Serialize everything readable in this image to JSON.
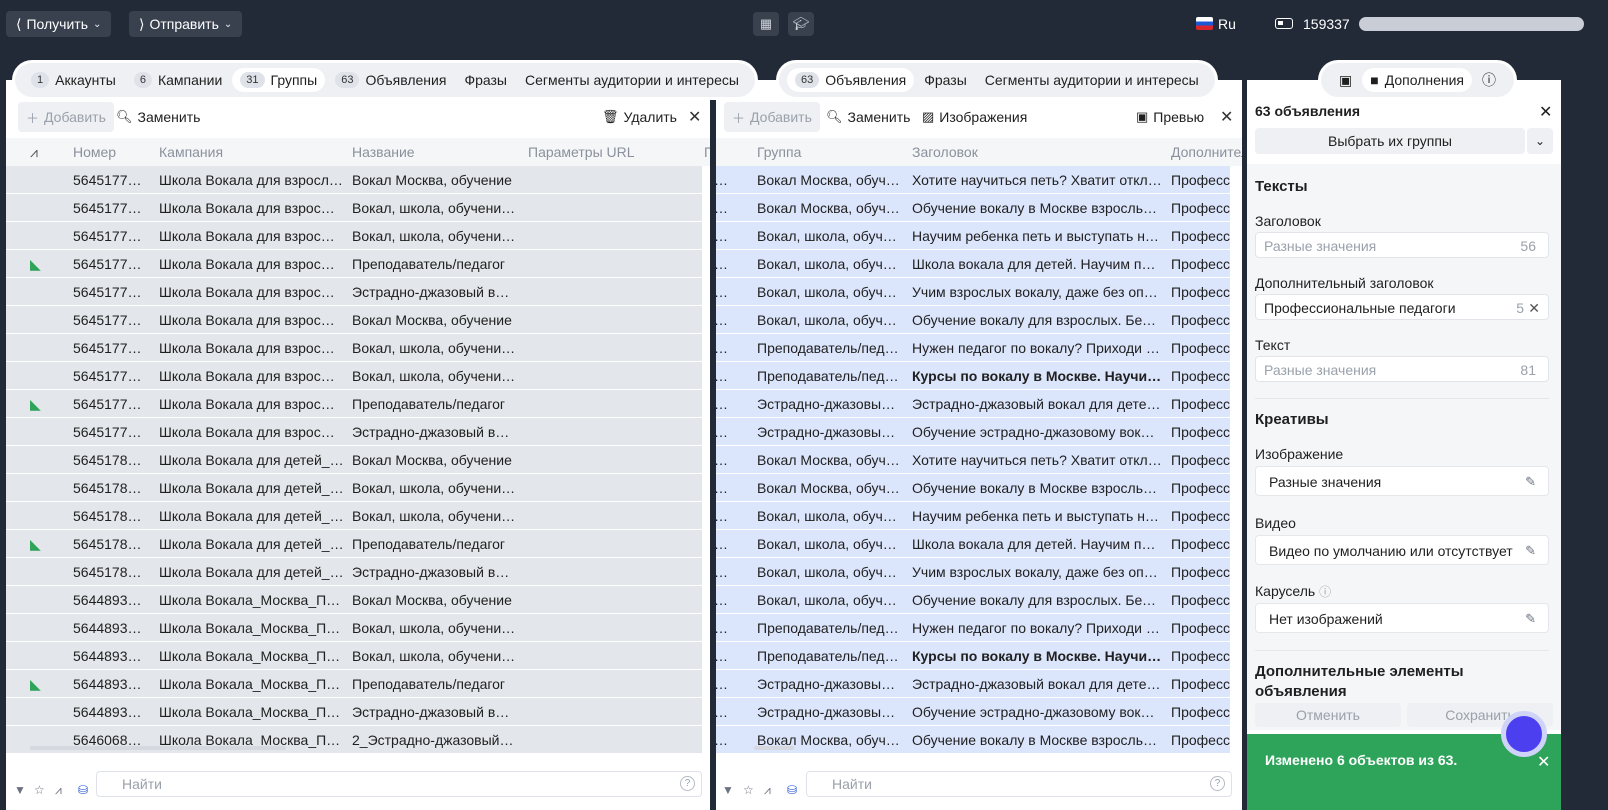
{
  "topbar": {
    "receive_label": "Получить",
    "send_label": "Отправить",
    "language": "Ru",
    "balance": "159337"
  },
  "left_panel": {
    "tabs": [
      {
        "count": "1",
        "label": "Аккаунты"
      },
      {
        "count": "6",
        "label": "Кампании"
      },
      {
        "count": "31",
        "label": "Группы"
      },
      {
        "count": "63",
        "label": "Объявления"
      },
      {
        "count": "",
        "label": "Фразы"
      },
      {
        "count": "",
        "label": "Сегменты аудитории и интересы"
      }
    ],
    "toolbar": {
      "add": "Добавить",
      "replace": "Заменить",
      "delete": "Удалить"
    },
    "columns": [
      "Номер",
      "Кампания",
      "Название",
      "Параметры URL"
    ],
    "rows": [
      {
        "flag": false,
        "num": "5645177…",
        "campaign": "Школа Вокала для взросл…",
        "name": "Вокал Москва, обучение"
      },
      {
        "flag": false,
        "num": "5645177…",
        "campaign": "Школа Вокала для взрос…",
        "name": "Вокал, школа, обучени…"
      },
      {
        "flag": false,
        "num": "5645177…",
        "campaign": "Школа Вокала для взрос…",
        "name": "Вокал, школа, обучени…"
      },
      {
        "flag": true,
        "num": "5645177…",
        "campaign": "Школа Вокала для взрос…",
        "name": "Преподаватель/педагог"
      },
      {
        "flag": false,
        "num": "5645177…",
        "campaign": "Школа Вокала для взрос…",
        "name": "Эстрадно-джазовый в…"
      },
      {
        "flag": false,
        "num": "5645177…",
        "campaign": "Школа Вокала для взрос…",
        "name": "Вокал Москва, обучение"
      },
      {
        "flag": false,
        "num": "5645177…",
        "campaign": "Школа Вокала для взрос…",
        "name": "Вокал, школа, обучени…"
      },
      {
        "flag": false,
        "num": "5645177…",
        "campaign": "Школа Вокала для взрос…",
        "name": "Вокал, школа, обучени…"
      },
      {
        "flag": true,
        "num": "5645177…",
        "campaign": "Школа Вокала для взрос…",
        "name": "Преподаватель/педагог"
      },
      {
        "flag": false,
        "num": "5645177…",
        "campaign": "Школа Вокала для взрос…",
        "name": "Эстрадно-джазовый в…"
      },
      {
        "flag": false,
        "num": "5645178…",
        "campaign": "Школа Вокала для детей_…",
        "name": "Вокал Москва, обучение"
      },
      {
        "flag": false,
        "num": "5645178…",
        "campaign": "Школа Вокала для детей_…",
        "name": "Вокал, школа, обучени…"
      },
      {
        "flag": false,
        "num": "5645178…",
        "campaign": "Школа Вокала для детей_…",
        "name": "Вокал, школа, обучени…"
      },
      {
        "flag": true,
        "num": "5645178…",
        "campaign": "Школа Вокала для детей_…",
        "name": "Преподаватель/педагог"
      },
      {
        "flag": false,
        "num": "5645178…",
        "campaign": "Школа Вокала для детей_…",
        "name": "Эстрадно-джазовый в…"
      },
      {
        "flag": false,
        "num": "5644893…",
        "campaign": "Школа Вокала_Москва_П…",
        "name": "Вокал Москва, обучение"
      },
      {
        "flag": false,
        "num": "5644893…",
        "campaign": "Школа Вокала_Москва_П…",
        "name": "Вокал, школа, обучени…"
      },
      {
        "flag": false,
        "num": "5644893…",
        "campaign": "Школа Вокала_Москва_П…",
        "name": "Вокал, школа, обучени…"
      },
      {
        "flag": true,
        "num": "5644893…",
        "campaign": "Школа Вокала_Москва_П…",
        "name": "Преподаватель/педагог"
      },
      {
        "flag": false,
        "num": "5644893…",
        "campaign": "Школа Вокала_Москва_П…",
        "name": "Эстрадно-джазовый в…"
      },
      {
        "flag": false,
        "num": "5646068…",
        "campaign": "Школа Вокала_Москва_П…",
        "name": "2_Эстрадно-джазовый…"
      }
    ],
    "search_placeholder": "Найти"
  },
  "mid_panel": {
    "tabs": [
      {
        "count": "63",
        "label": "Объявления"
      },
      {
        "count": "",
        "label": "Фразы"
      },
      {
        "count": "",
        "label": "Сегменты аудитории и интересы"
      }
    ],
    "toolbar": {
      "add": "Добавить",
      "replace": "Заменить",
      "images": "Изображения",
      "preview": "Превью"
    },
    "columns": [
      "Группа",
      "Заголовок",
      "Дополнител"
    ],
    "rows": [
      {
        "group": "Вокал Москва, обуч…",
        "title": "Хотите научиться петь? Хватит откл…",
        "bold": false,
        "extra": "Професс"
      },
      {
        "group": "Вокал Москва, обуч…",
        "title": "Обучение вокалу в Москве взросль…",
        "bold": false,
        "extra": "Професс"
      },
      {
        "group": "Вокал, школа, обуч…",
        "title": "Научим ребенка петь и выступать н…",
        "bold": false,
        "extra": "Професс"
      },
      {
        "group": "Вокал, школа, обуч…",
        "title": "Школа вокала для детей. Научим пе…",
        "bold": false,
        "extra": "Професс"
      },
      {
        "group": "Вокал, школа, обуч…",
        "title": "Учим взрослых вокалу, даже без оп…",
        "bold": false,
        "extra": "Професс"
      },
      {
        "group": "Вокал, школа, обуч…",
        "title": "Обучение вокалу для взрослых. Без…",
        "bold": false,
        "extra": "Професс"
      },
      {
        "group": "Преподаватель/пед…",
        "title": "Нужен педагог по вокалу? Приходи …",
        "bold": false,
        "extra": "Професс"
      },
      {
        "group": "Преподаватель/пед…",
        "title": "Курсы по вокалу в Москве. Научи…",
        "bold": true,
        "extra": "Професс"
      },
      {
        "group": "Эстрадно-джазовы…",
        "title": "Эстрадно-джазовый вокал для дете…",
        "bold": false,
        "extra": "Професс"
      },
      {
        "group": "Эстрадно-джазовы…",
        "title": "Обучение эстрадно-джазовому вок…",
        "bold": false,
        "extra": "Професс"
      },
      {
        "group": "Вокал Москва, обуч…",
        "title": "Хотите научиться петь? Хватит откл…",
        "bold": false,
        "extra": "Професс"
      },
      {
        "group": "Вокал Москва, обуч…",
        "title": "Обучение вокалу в Москве взросль…",
        "bold": false,
        "extra": "Професс"
      },
      {
        "group": "Вокал, школа, обуч…",
        "title": "Научим ребенка петь и выступать н…",
        "bold": false,
        "extra": "Професс"
      },
      {
        "group": "Вокал, школа, обуч…",
        "title": "Школа вокала для детей. Научим пе…",
        "bold": false,
        "extra": "Професс"
      },
      {
        "group": "Вокал, школа, обуч…",
        "title": "Учим взрослых вокалу, даже без оп…",
        "bold": false,
        "extra": "Професс"
      },
      {
        "group": "Вокал, школа, обуч…",
        "title": "Обучение вокалу для взрослых. Без…",
        "bold": false,
        "extra": "Професс"
      },
      {
        "group": "Преподаватель/пед…",
        "title": "Нужен педагог по вокалу? Приходи …",
        "bold": false,
        "extra": "Професс"
      },
      {
        "group": "Преподаватель/пед…",
        "title": "Курсы по вокалу в Москве. Научи…",
        "bold": true,
        "extra": "Професс"
      },
      {
        "group": "Эстрадно-джазовы…",
        "title": "Эстрадно-джазовый вокал для дете…",
        "bold": false,
        "extra": "Професс"
      },
      {
        "group": "Эстрадно-джазовы…",
        "title": "Обучение эстрадно-джазовому вок…",
        "bold": false,
        "extra": "Професс"
      },
      {
        "group": "Вокал Москва, обуч…",
        "title": "Обучение вокалу в Москве взросль…",
        "bold": false,
        "extra": "Професс"
      }
    ],
    "search_placeholder": "Найти"
  },
  "right_panel": {
    "tab_label": "Дополнения",
    "heading": "63 объявления",
    "choose_group": "Выбрать их группы",
    "texts_section": "Тексты",
    "title_label": "Заголовок",
    "title_placeholder": "Разные значения",
    "title_count": "56",
    "extra_title_label": "Дополнительный заголовок",
    "extra_title_value": "Профессиональные педагоги",
    "extra_title_count": "5",
    "text_label": "Текст",
    "text_placeholder": "Разные значения",
    "text_count": "81",
    "creatives_section": "Креативы",
    "image_label": "Изображение",
    "image_value": "Разные значения",
    "video_label": "Видео",
    "video_value": "Видео по умолчанию или отсутствует",
    "carousel_label": "Карусель",
    "carousel_value": "Нет изображений",
    "extras_section_line1": "Дополнительные элементы",
    "extras_section_line2": "объявления",
    "cancel": "Отменить",
    "save": "Сохранить",
    "toast": "Изменено 6 объектов из 63."
  }
}
